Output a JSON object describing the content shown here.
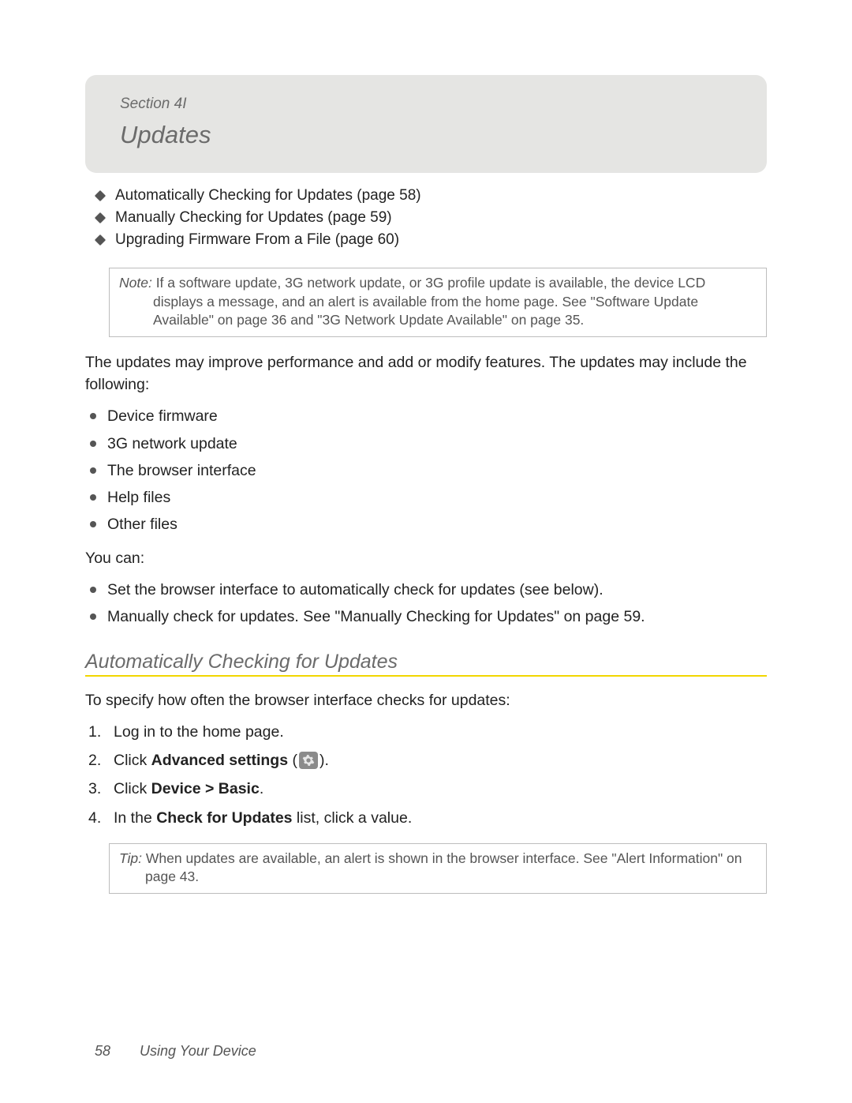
{
  "header": {
    "section_label": "Section 4I",
    "title": "Updates"
  },
  "toc": [
    "Automatically Checking for Updates (page 58)",
    "Manually Checking for Updates (page 59)",
    "Upgrading Firmware From a File (page 60)"
  ],
  "note": {
    "lead": "Note:",
    "body": " If a software update, 3G network update, or 3G profile update is available, the device LCD displays a message, and an alert is available from the home page. See \"Software Update Available\" on page 36 and \"3G Network Update Available\" on page 35."
  },
  "intro_para": "The updates may improve performance and add or modify features. The updates may include the following:",
  "include_list": [
    "Device firmware",
    "3G network update",
    "The browser interface",
    "Help files",
    "Other files"
  ],
  "you_can_label": "You can:",
  "you_can_list": [
    "Set the browser interface to automatically check for updates (see below).",
    "Manually check for updates. See \"Manually Checking for Updates\" on page 59."
  ],
  "subheading": "Automatically Checking for Updates",
  "sub_intro": "To specify how often the browser interface checks for updates:",
  "steps": {
    "s1": "Log in to the home page.",
    "s2_pre": "Click ",
    "s2_bold": "Advanced settings",
    "s2_post_open": " (",
    "s2_post_close": ").",
    "s3_pre": "Click ",
    "s3_bold": "Device > Basic",
    "s3_post": ".",
    "s4_pre": "In the ",
    "s4_bold": "Check for Updates",
    "s4_post": " list, click a value."
  },
  "tip": {
    "lead": "Tip:",
    "body": " When updates are available, an alert is shown in the browser interface. See \"Alert Information\" on page 43."
  },
  "footer": {
    "page_number": "58",
    "chapter": "Using Your Device"
  }
}
